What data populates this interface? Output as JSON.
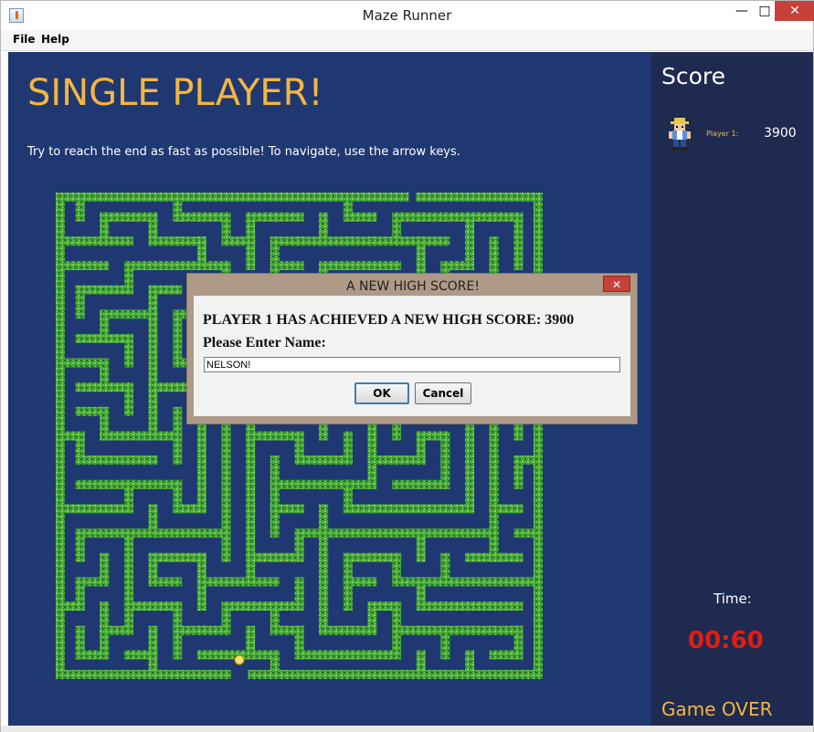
{
  "window": {
    "title": "Maze Runner",
    "minimize_glyph": "—",
    "maximize_glyph": "□",
    "close_glyph": "✕"
  },
  "menu": {
    "file": "File",
    "help": "Help"
  },
  "game": {
    "heading": "SINGLE PLAYER!",
    "instructions": "Try to reach the end as fast as possible! To navigate, use the arrow keys."
  },
  "score_panel": {
    "title": "Score",
    "player_label": "Player 1:",
    "player_score": "3900",
    "time_label": "Time:",
    "time_value": "00:60",
    "status": "Game OVER"
  },
  "dialog": {
    "title": "A NEW HIGH SCORE!",
    "close_glyph": "✕",
    "message": "PLAYER 1 HAS ACHIEVED A NEW HIGH SCORE: 3900",
    "prompt": "Please Enter Name:",
    "name_value": "NELSON!",
    "ok_label": "OK",
    "cancel_label": "Cancel"
  },
  "colors": {
    "game_bg": "#1f3872",
    "score_bg": "#1f2a50",
    "accent_yellow": "#f3b640",
    "timer_red": "#e21d12",
    "wall_green": "#3fa33a",
    "dialog_frame": "#ae9a86"
  },
  "icons": [
    "java-app-icon",
    "player-sprite-icon",
    "close-icon"
  ]
}
